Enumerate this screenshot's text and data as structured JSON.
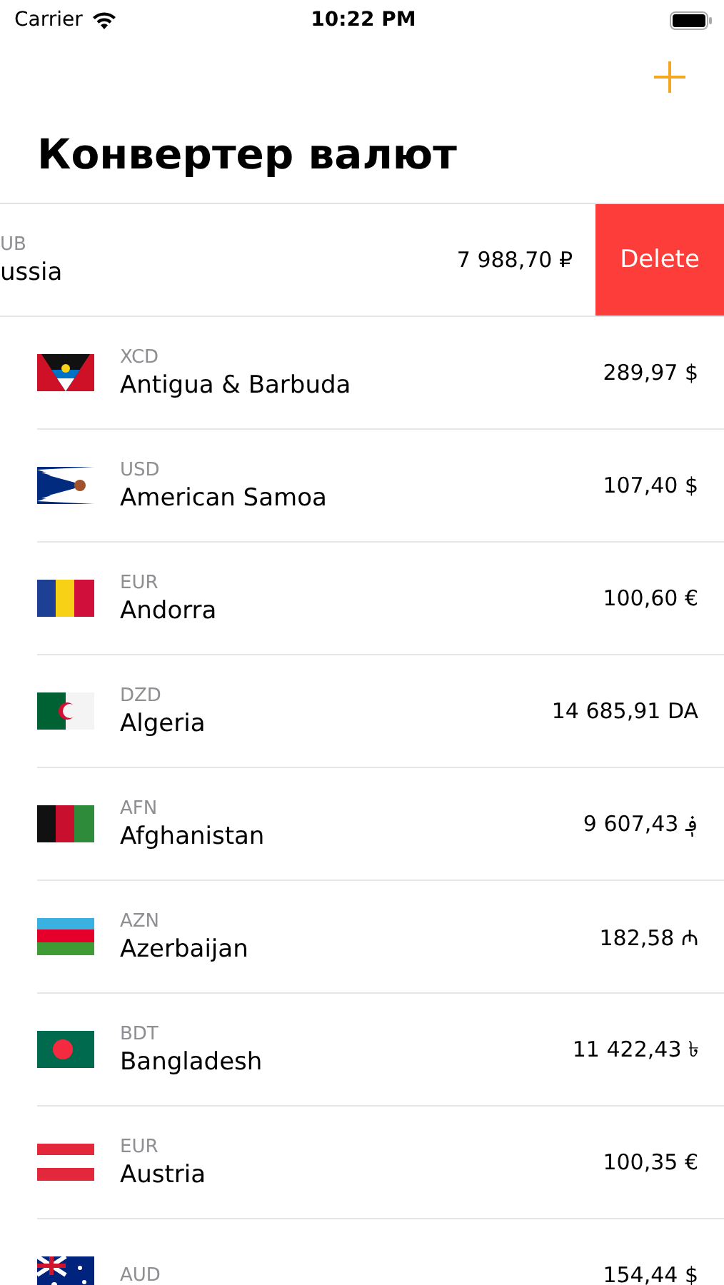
{
  "status_bar": {
    "carrier": "Carrier",
    "time": "10:22 PM"
  },
  "nav": {
    "title": "Конвертер валют"
  },
  "currencies": [
    {
      "code": "UB",
      "country": "ussia",
      "amount": "7 988,70 ₽",
      "swiped": true,
      "action": "Delete"
    },
    {
      "code": "XCD",
      "country": "Antigua & Barbuda",
      "amount": "289,97 $",
      "swiped": false
    },
    {
      "code": "USD",
      "country": "American Samoa",
      "amount": "107,40 $",
      "swiped": false
    },
    {
      "code": "EUR",
      "country": "Andorra",
      "amount": "100,60 €",
      "swiped": false
    },
    {
      "code": "DZD",
      "country": "Algeria",
      "amount": "14 685,91 DA",
      "swiped": false
    },
    {
      "code": "AFN",
      "country": "Afghanistan",
      "amount": "9 607,43 ؋",
      "swiped": false
    },
    {
      "code": "AZN",
      "country": "Azerbaijan",
      "amount": "182,58 ₼",
      "swiped": false
    },
    {
      "code": "BDT",
      "country": "Bangladesh",
      "amount": "11 422,43 ৳",
      "swiped": false
    },
    {
      "code": "EUR",
      "country": "Austria",
      "amount": "100,35 €",
      "swiped": false
    },
    {
      "code": "AUD",
      "amount": "154,44 $",
      "swiped": false
    }
  ]
}
